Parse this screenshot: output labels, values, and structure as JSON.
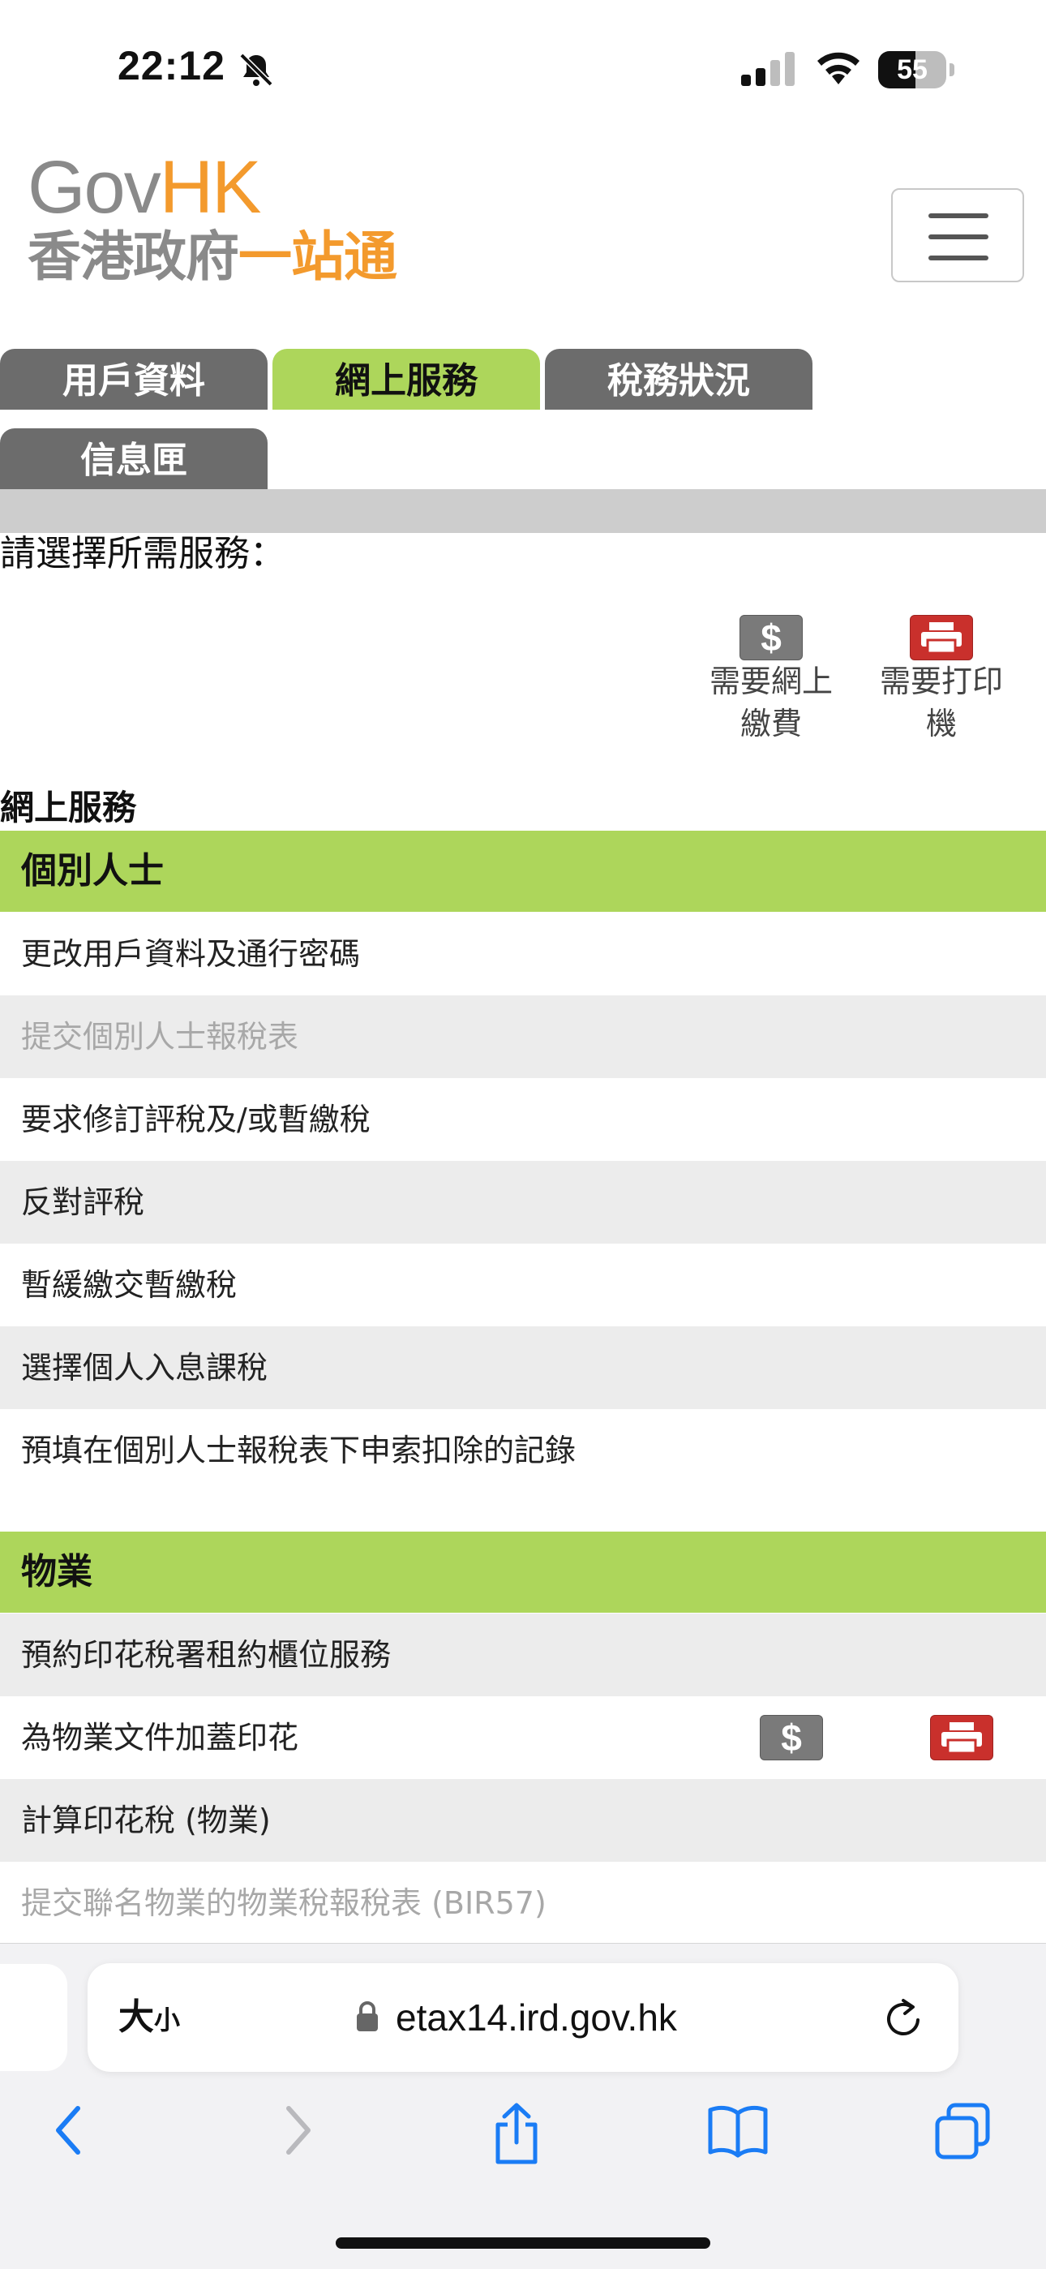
{
  "status_bar": {
    "time": "22:12",
    "battery": "55",
    "battery_level": 0.55
  },
  "header": {
    "logo_gov": "Gov",
    "logo_hk": "HK",
    "logo_cn_grey": "香港政府",
    "logo_cn_orange": "一站通"
  },
  "tabs": [
    {
      "label": "用戶資料",
      "active": false
    },
    {
      "label": "網上服務",
      "active": true
    },
    {
      "label": "稅務狀況",
      "active": false
    },
    {
      "label": "信息匣",
      "active": false
    }
  ],
  "prompt": "請選擇所需服務：",
  "legend": {
    "payment_label_1": "需要網上",
    "payment_label_2": "繳費",
    "printer_label_1": "需要打印",
    "printer_label_2": "機"
  },
  "section_heading": "網上服務",
  "categories": [
    {
      "title": "個別人士",
      "items": [
        {
          "label": "更改用戶資料及通行密碼"
        },
        {
          "label": "提交個別人士報稅表"
        },
        {
          "label": "要求修訂評稅及/或暫繳稅"
        },
        {
          "label": "反對評稅"
        },
        {
          "label": "暫緩繳交暫繳稅"
        },
        {
          "label": "選擇個人入息課稅"
        },
        {
          "label": "預填在個別人士報稅表下申索扣除的記錄"
        }
      ]
    },
    {
      "title": "物業",
      "items": [
        {
          "label": "預約印花稅署租約櫃位服務"
        },
        {
          "label": "為物業文件加蓋印花"
        },
        {
          "label": "計算印花稅 (物業)"
        },
        {
          "label": "提交聯名物業的物業稅報稅表 (BIR57)"
        }
      ]
    }
  ],
  "colors": {
    "accent_green": "#add65b",
    "brand_orange": "#f39a2d",
    "tab_gray": "#6c6c6c",
    "printer_red": "#c9302c"
  },
  "browser": {
    "text_size_big": "大",
    "text_size_small": "小",
    "url": "etax14.ird.gov.hk"
  }
}
